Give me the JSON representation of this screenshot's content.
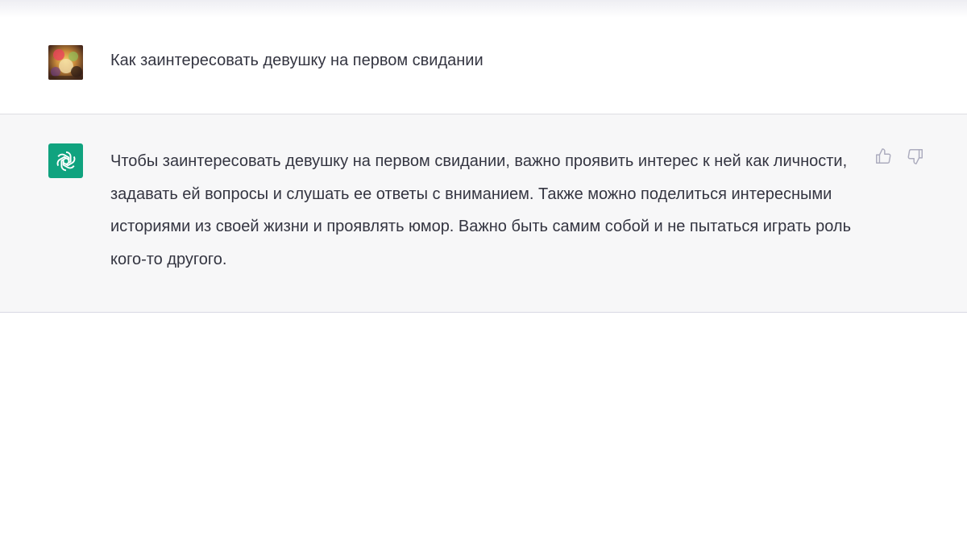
{
  "conversation": {
    "user_message": {
      "text": "Как заинтересовать девушку на первом свидании",
      "avatar_icon": "user-avatar-photo"
    },
    "assistant_message": {
      "text": "Чтобы заинтересовать девушку на первом свидании, важно проявить интерес к ней как личности, задавать ей вопросы и слушать ее ответы с вниманием. Также можно поделиться интересными историями из своей жизни и проявлять юмор. Важно быть самим собой и не пытаться играть роль кого-то другого.",
      "avatar_icon": "openai-logo-icon",
      "actions": [
        "thumbs-up-icon",
        "thumbs-down-icon"
      ]
    }
  },
  "colors": {
    "assistant_bg": "#f7f7f8",
    "assistant_avatar": "#10a37f",
    "text": "#343541"
  }
}
